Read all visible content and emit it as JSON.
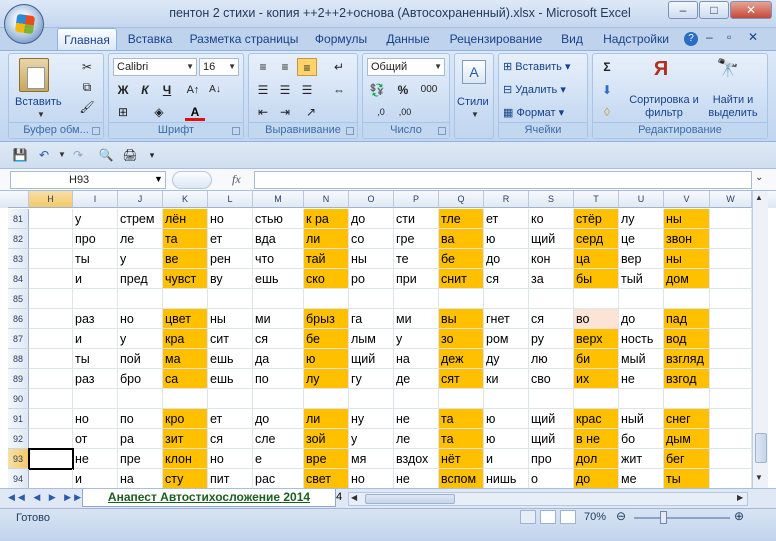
{
  "window": {
    "title": "пентон 2 стихи - копия  ++2++2+основа (Автосохраненный).xlsx - Microsoft Excel",
    "min": "–",
    "max": "□",
    "close": "✕"
  },
  "tabs": [
    "Главная",
    "Вставка",
    "Разметка страницы",
    "Формулы",
    "Данные",
    "Рецензирование",
    "Вид",
    "Надстройки"
  ],
  "ribbon": {
    "clipboard": {
      "paste": "Вставить",
      "label": "Буфер обм..."
    },
    "font": {
      "name": "Calibri",
      "size": "16",
      "bold": "Ж",
      "italic": "К",
      "underline": "Ч",
      "label": "Шрифт"
    },
    "alignment": {
      "label": "Выравнивание"
    },
    "number": {
      "format": "Общий",
      "label": "Число"
    },
    "styles": {
      "label": "Стили"
    },
    "cells": {
      "insert": "Вставить",
      "delete": "Удалить",
      "format": "Формат",
      "label": "Ячейки"
    },
    "editing": {
      "sort": "Сортировка и фильтр",
      "find": "Найти и выделить",
      "label": "Редактирование"
    }
  },
  "formula_bar": {
    "name_box": "H93",
    "fx": "fx",
    "value": ""
  },
  "columns": [
    "H",
    "I",
    "J",
    "K",
    "L",
    "M",
    "N",
    "O",
    "P",
    "Q",
    "R",
    "S",
    "T",
    "U",
    "V",
    "W"
  ],
  "rows": [
    {
      "n": "81",
      "cells": [
        "",
        "у",
        "стрем",
        "лён",
        "но",
        "стью",
        "к ра",
        "до",
        "сти",
        "тле",
        "ет",
        "ко",
        "стёр",
        "лу",
        "ны",
        ""
      ]
    },
    {
      "n": "82",
      "cells": [
        "",
        "про",
        "ле",
        "та",
        "ет",
        "вда",
        "ли",
        "со",
        "гре",
        "ва",
        "ю",
        "щий",
        "серд",
        "це",
        "звон",
        ""
      ]
    },
    {
      "n": "83",
      "cells": [
        "",
        "ты",
        "у",
        "ве",
        "рен",
        "что",
        "тай",
        "ны",
        "те",
        "бе",
        "до",
        "кон",
        "ца",
        "вер",
        "ны",
        ""
      ]
    },
    {
      "n": "84",
      "cells": [
        "",
        "и",
        "пред",
        "чувст",
        "ву",
        "ешь",
        "ско",
        "ро",
        "при",
        "снит",
        "ся",
        "за",
        "бы",
        "тый",
        "дом",
        ""
      ]
    },
    {
      "n": "85",
      "cells": [
        "",
        "",
        "",
        "",
        "",
        "",
        "",
        "",
        "",
        "",
        "",
        "",
        "",
        "",
        "",
        ""
      ]
    },
    {
      "n": "86",
      "cells": [
        "",
        "раз",
        "но",
        "цвет",
        "ны",
        "ми",
        "брыз",
        "га",
        "ми",
        "вы",
        "гнет",
        "ся",
        "во",
        "до",
        "пад",
        ""
      ]
    },
    {
      "n": "87",
      "cells": [
        "",
        "и",
        "у",
        "кра",
        "сит",
        "ся",
        "бе",
        "лым",
        "у",
        "зо",
        "ром",
        "ру",
        "верх",
        "ность",
        "вод",
        ""
      ]
    },
    {
      "n": "88",
      "cells": [
        "",
        "ты",
        "пой",
        "ма",
        "ешь",
        "да",
        "ю",
        "щий",
        "на",
        "деж",
        "ду",
        "лю",
        "би",
        "мый",
        "взгляд",
        ""
      ]
    },
    {
      "n": "89",
      "cells": [
        "",
        "раз",
        "бро",
        "са",
        "ешь",
        "по",
        "лу",
        "гу",
        "де",
        "сят",
        "ки",
        "сво",
        "их",
        "не",
        "взгод",
        ""
      ]
    },
    {
      "n": "90",
      "cells": [
        "",
        "",
        "",
        "",
        "",
        "",
        "",
        "",
        "",
        "",
        "",
        "",
        "",
        "",
        "",
        ""
      ]
    },
    {
      "n": "91",
      "cells": [
        "",
        "но",
        "по",
        "кро",
        "ет",
        "до",
        "ли",
        "ну",
        "не",
        "та",
        "ю",
        "щий",
        "крас",
        "ный",
        "снег",
        ""
      ]
    },
    {
      "n": "92",
      "cells": [
        "",
        "от",
        "ра",
        "зит",
        "ся",
        "сле",
        "зой",
        "у",
        "ле",
        "та",
        "ю",
        "щий",
        "в не",
        "бо",
        "дым",
        ""
      ]
    },
    {
      "n": "93",
      "cells": [
        "",
        "не",
        "пре",
        "клон",
        "но",
        "е",
        "вре",
        "мя",
        "вздох",
        "нёт",
        "и",
        "про",
        "дол",
        "жит",
        "бег",
        ""
      ]
    },
    {
      "n": "94",
      "cells": [
        "",
        "и",
        "на",
        "сту",
        "пит",
        "рас",
        "свет",
        "но",
        "не",
        "вспом",
        "нишь",
        "о",
        "до",
        "ме",
        "ты",
        ""
      ]
    }
  ],
  "sheet_tab": "Анапест Автостихосложение 2014",
  "sheet_tab_more": "4",
  "status": {
    "ready": "Готово",
    "zoom": "70%"
  },
  "colors": {
    "highlight": "#ffc000",
    "pale": "#fbe4d5"
  }
}
